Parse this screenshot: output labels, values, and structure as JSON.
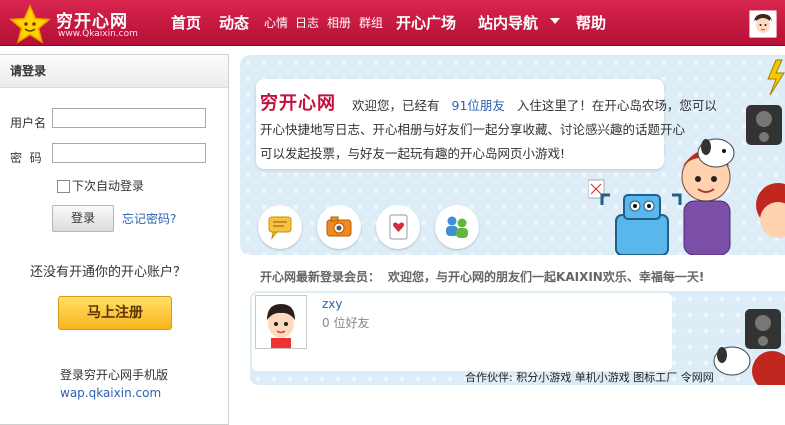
{
  "site": {
    "name": "穷开心网",
    "url": "www.Qkaixin.com"
  },
  "nav": {
    "items": [
      {
        "label": "首页"
      },
      {
        "label": "动态"
      },
      {
        "label": "心情"
      },
      {
        "label": "日志"
      },
      {
        "label": "相册"
      },
      {
        "label": "群组"
      },
      {
        "label": "开心广场"
      },
      {
        "label": "站内导航"
      },
      {
        "label": "帮助"
      }
    ]
  },
  "login": {
    "title": "请登录",
    "username_label": "用户名",
    "password_label": "密  码",
    "username_value": "",
    "password_value": "",
    "remember_label": "下次自动登录",
    "remember_checked": false,
    "login_button": "登录",
    "forgot_link": "忘记密码?",
    "no_account_text": "还没有开通你的开心账户？",
    "register_button": "马上注册",
    "mobile_text": "登录穷开心网手机版",
    "mobile_link": "wap.qkaixin.com"
  },
  "banner": {
    "title": "穷开心网",
    "welcome_a": "欢迎您，已经有",
    "friend_count": "91位朋友",
    "welcome_b": "入住这里了！在开心岛农场，您可以",
    "line2": "开心快捷地写日志、开心相册与好友们一起分享收藏、讨论感兴趣的话题开心",
    "line3": "可以发起投票，与好友一起玩有趣的开心岛网页小游戏!",
    "features": [
      {
        "icon": "chat-bubble-icon"
      },
      {
        "icon": "camera-icon"
      },
      {
        "icon": "playing-card-icon"
      },
      {
        "icon": "people-group-icon"
      }
    ]
  },
  "members": {
    "heading": "开心网最新登录会员：",
    "subheading": "欢迎您，与开心网的朋友们一起KAIXIN欢乐、幸福每一天!",
    "list": [
      {
        "name": "zxy",
        "friends": "0 位好友"
      }
    ]
  },
  "partners": {
    "label": "合作伙伴:",
    "links": [
      "积分小游戏",
      "单机小游戏",
      "图标工厂",
      "令网网"
    ]
  },
  "colors": {
    "brand": "#c8173f",
    "link": "#2a62b3",
    "banner_bg": "#dcedf8",
    "register": "#f8b41c"
  }
}
